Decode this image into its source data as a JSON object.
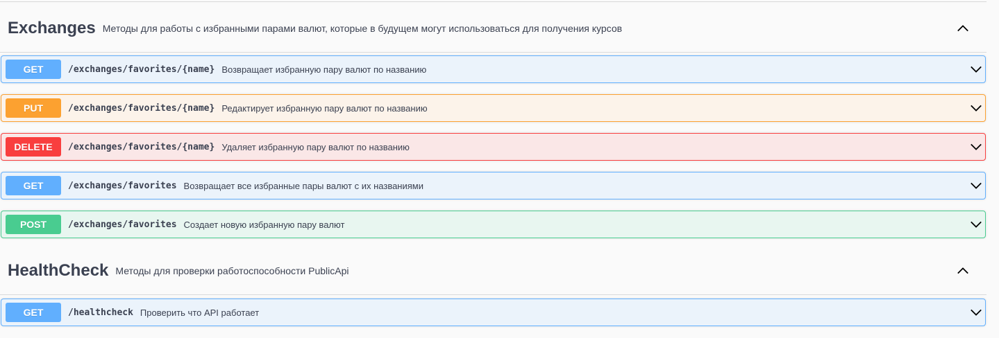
{
  "sections": [
    {
      "title": "Exchanges",
      "description": "Методы для работы с избранными парами валют, которые в будущем могут использоваться для получения курсов",
      "toggle_icon": "chevron-up-icon",
      "operations": [
        {
          "method": "GET",
          "path": "/exchanges/favorites/{name}",
          "summary": "Возвращает избранную пару валют по названию"
        },
        {
          "method": "PUT",
          "path": "/exchanges/favorites/{name}",
          "summary": "Редактирует избранную пару валют по названию"
        },
        {
          "method": "DELETE",
          "path": "/exchanges/favorites/{name}",
          "summary": "Удаляет избранную пару валют по названию"
        },
        {
          "method": "GET",
          "path": "/exchanges/favorites",
          "summary": "Возвращает все избранные пары валют с их названиями"
        },
        {
          "method": "POST",
          "path": "/exchanges/favorites",
          "summary": "Создает новую избранную пару валют"
        }
      ]
    },
    {
      "title": "HealthCheck",
      "description": "Методы для проверки работоспособности PublicApi",
      "toggle_icon": "chevron-up-icon",
      "operations": [
        {
          "method": "GET",
          "path": "/healthcheck",
          "summary": "Проверить что API работает"
        }
      ]
    }
  ],
  "colors": {
    "get": "#61affe",
    "put": "#fca130",
    "delete": "#f93e3e",
    "post": "#49cc90",
    "text": "#3b4151"
  },
  "operation_toggle_icon": "chevron-down-icon"
}
